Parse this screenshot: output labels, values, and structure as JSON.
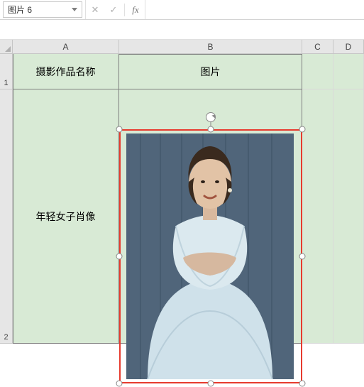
{
  "formula_bar": {
    "name_box_value": "图片 6",
    "cancel_glyph": "✕",
    "confirm_glyph": "✓",
    "fx_label": "fx",
    "formula_value": ""
  },
  "columns": {
    "A": "A",
    "B": "B",
    "C": "C",
    "D": "D"
  },
  "rows": {
    "r1": "1",
    "r2": "2"
  },
  "cells": {
    "A1": "摄影作品名称",
    "B1": "图片",
    "A2": "年轻女子肖像"
  },
  "picture": {
    "name": "图片 6",
    "outline_color": "#e73b2e"
  }
}
